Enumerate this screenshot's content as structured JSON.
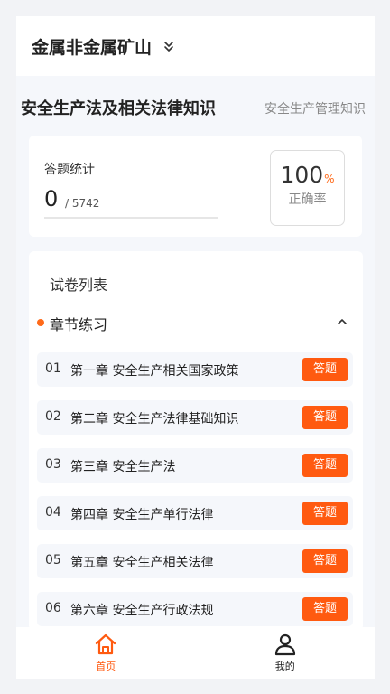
{
  "header": {
    "category": "金属非金属矿山"
  },
  "subjects": {
    "active": "安全生产法及相关法律知识",
    "other": "安全生产管理知识"
  },
  "stats": {
    "label": "答题统计",
    "answered": "0",
    "total": "/ 5742",
    "rate_value": "100",
    "rate_symbol": "%",
    "rate_label": "正确率"
  },
  "exam_list": {
    "title": "试卷列表",
    "section_name": "章节练习",
    "chapters": [
      {
        "num": "01",
        "name": "第一章 安全生产相关国家政策",
        "action": "答题"
      },
      {
        "num": "02",
        "name": "第二章 安全生产法律基础知识",
        "action": "答题"
      },
      {
        "num": "03",
        "name": "第三章 安全生产法",
        "action": "答题"
      },
      {
        "num": "04",
        "name": "第四章 安全生产单行法律",
        "action": "答题"
      },
      {
        "num": "05",
        "name": "第五章 安全生产相关法律",
        "action": "答题"
      },
      {
        "num": "06",
        "name": "第六章 安全生产行政法规",
        "action": "答题"
      }
    ]
  },
  "nav": {
    "home_label": "首页",
    "me_label": "我的"
  },
  "colors": {
    "accent": "#ff5a10",
    "background": "#f5f7fb"
  }
}
